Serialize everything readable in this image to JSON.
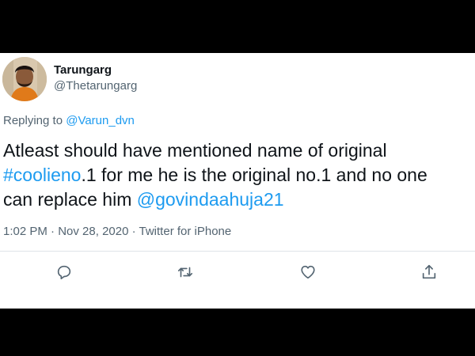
{
  "user": {
    "name": "Tarungarg",
    "handle": "@Thetarungarg"
  },
  "reply": {
    "prefix": "Replying to ",
    "mention": "@Varun_dvn"
  },
  "tweet": {
    "line1": "Atleast should have mentioned name of original",
    "hashtag": "#coolieno",
    "line2_rest": ".1 for me he is the original no.1 and no one",
    "line3_prefix": "can replace him ",
    "mention": "@govindaahuja21"
  },
  "meta": {
    "time": "1:02 PM",
    "sep1": " · ",
    "date": "Nov 28, 2020",
    "sep2": " · ",
    "source": "Twitter for iPhone"
  },
  "actions": {
    "reply_icon": "reply-icon",
    "retweet_icon": "retweet-icon",
    "like_icon": "heart-icon",
    "share_icon": "share-icon"
  },
  "colors": {
    "link": "#1d9bf0",
    "secondary": "#536471",
    "text": "#0f1419",
    "background": "#ffffff",
    "letterbox": "#000000"
  }
}
